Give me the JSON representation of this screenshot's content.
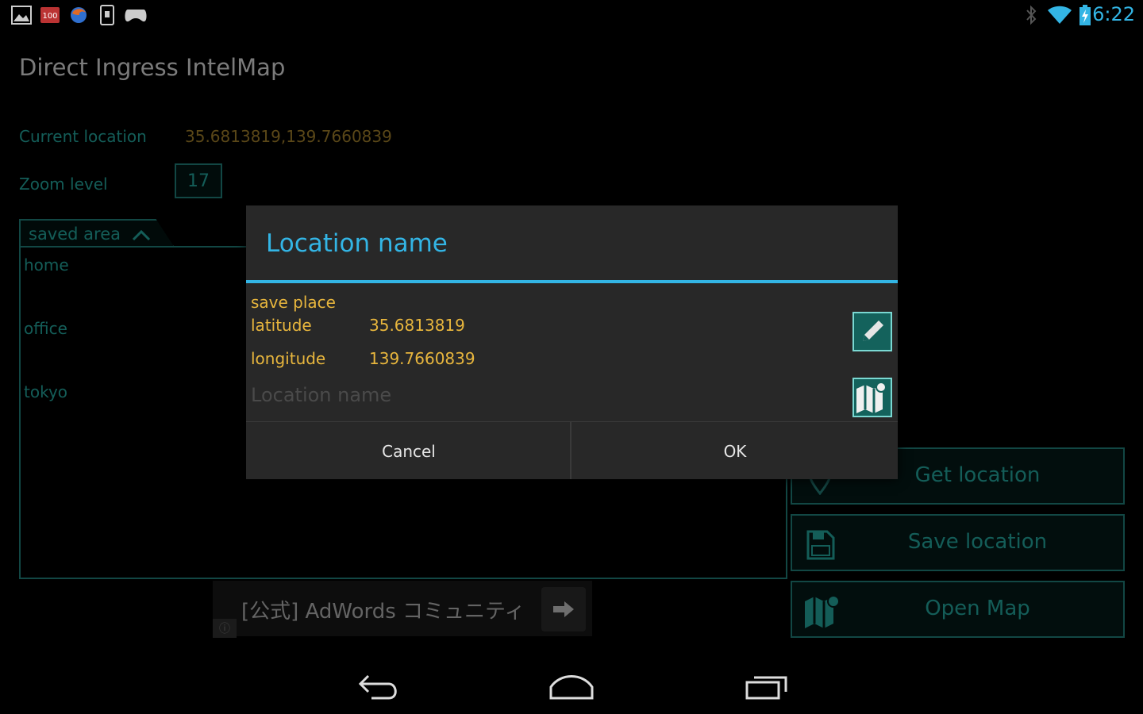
{
  "status_bar": {
    "time": "6:22",
    "icons": [
      "gallery-icon",
      "notification-100-icon",
      "firefox-icon",
      "device-icon",
      "game-controller-icon",
      "bluetooth-icon",
      "wifi-icon",
      "battery-charging-icon"
    ]
  },
  "app": {
    "title": "Direct Ingress IntelMap"
  },
  "form": {
    "current_location_label": "Current location",
    "current_location_value": "35.6813819,139.7660839",
    "zoom_label": "Zoom level",
    "zoom_value": "17"
  },
  "saved_area": {
    "label": "saved area",
    "items": [
      "home",
      "office",
      "tokyo"
    ]
  },
  "buttons": {
    "get_location": "Get location",
    "save_location": "Save location",
    "open_map": "Open Map"
  },
  "ad": {
    "text": "[公式] AdWords コミュニティ",
    "info": "ⓘ"
  },
  "dialog": {
    "title": "Location name",
    "save_place_label": "save place",
    "latitude_label": "latitude",
    "latitude_value": "35.6813819",
    "longitude_label": "longitude",
    "longitude_value": "139.7660839",
    "name_placeholder": "Location name",
    "cancel_label": "Cancel",
    "ok_label": "OK"
  },
  "colors": {
    "accent": "#33b5e5",
    "teal": "#1f8f88",
    "gold": "#e8b63d",
    "dialog_bg": "#282828"
  }
}
